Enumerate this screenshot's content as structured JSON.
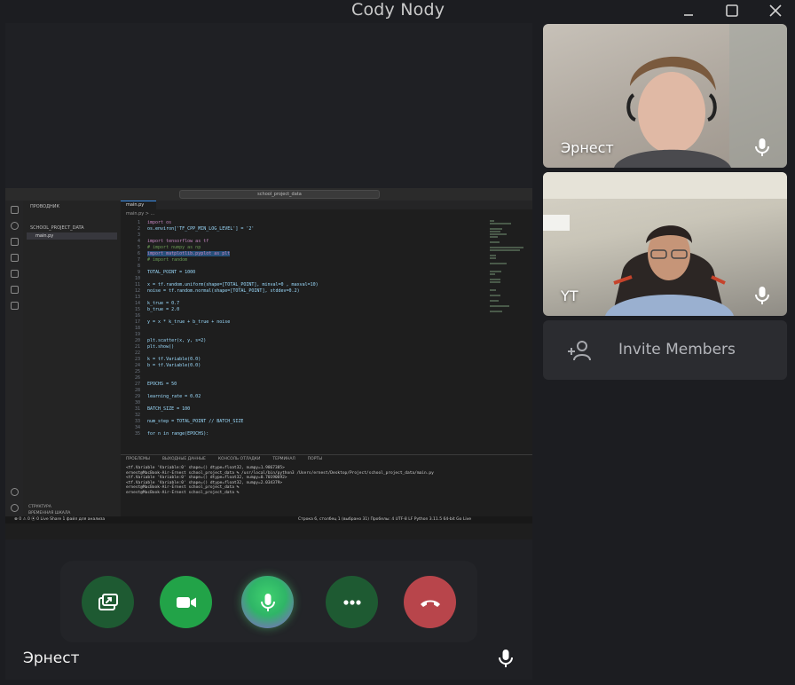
{
  "window": {
    "title": "Cody Nody"
  },
  "main_video": {
    "participant_name": "Эрнест"
  },
  "screen_share": {
    "search_text": "school_project_data",
    "explorer_title": "ПРОВОДНИК",
    "project_folder": "SCHOOL_PROJECT_DATA",
    "file": "main.py",
    "tab": "main.py",
    "breadcrumb": "main.py > ...",
    "outline_1": "СТРУКТУРА",
    "outline_2": "ВРЕМЕННАЯ ШКАЛА",
    "code_lines": [
      {
        "n": "1",
        "t": "import os"
      },
      {
        "n": "2",
        "t": "os.environ['TF_CPP_MIN_LOG_LEVEL'] = '2'"
      },
      {
        "n": "3",
        "t": ""
      },
      {
        "n": "4",
        "t": "import tensorflow as tf"
      },
      {
        "n": "5",
        "t": "# import numpy as np"
      },
      {
        "n": "6",
        "t": "import matplotlib.pyplot as plt"
      },
      {
        "n": "7",
        "t": "# import random"
      },
      {
        "n": "8",
        "t": ""
      },
      {
        "n": "9",
        "t": "TOTAL_POINT = 1000"
      },
      {
        "n": "10",
        "t": ""
      },
      {
        "n": "11",
        "t": "x = tf.random.uniform(shape=[TOTAL_POINT], minval=0 , maxval=10)"
      },
      {
        "n": "12",
        "t": "noise = tf.random.normal(shape=[TOTAL_POINT], stddev=0.2)"
      },
      {
        "n": "13",
        "t": ""
      },
      {
        "n": "14",
        "t": "k_true = 0.7"
      },
      {
        "n": "15",
        "t": "b_true = 2.0"
      },
      {
        "n": "16",
        "t": ""
      },
      {
        "n": "17",
        "t": "y = x * k_true + b_true + noise"
      },
      {
        "n": "18",
        "t": ""
      },
      {
        "n": "19",
        "t": ""
      },
      {
        "n": "20",
        "t": "plt.scatter(x, y, s=2)"
      },
      {
        "n": "21",
        "t": "plt.show()"
      },
      {
        "n": "22",
        "t": ""
      },
      {
        "n": "23",
        "t": "k = tf.Variable(0.0)"
      },
      {
        "n": "24",
        "t": "b = tf.Variable(0.0)"
      },
      {
        "n": "25",
        "t": ""
      },
      {
        "n": "26",
        "t": ""
      },
      {
        "n": "27",
        "t": "EPOCHS = 50"
      },
      {
        "n": "28",
        "t": ""
      },
      {
        "n": "29",
        "t": "learning_rate = 0.02"
      },
      {
        "n": "30",
        "t": ""
      },
      {
        "n": "31",
        "t": "BATCH_SIZE = 100"
      },
      {
        "n": "32",
        "t": ""
      },
      {
        "n": "33",
        "t": "num_step = TOTAL_POINT // BATCH_SIZE"
      },
      {
        "n": "34",
        "t": ""
      },
      {
        "n": "35",
        "t": "for n in range(EPOCHS):"
      }
    ],
    "panel_tabs": [
      "ПРОБЛЕМЫ",
      "ВЫХОДНЫЕ ДАННЫЕ",
      "КОНСОЛЬ ОТЛАДКИ",
      "ТЕРМИНАЛ",
      "ПОРТЫ"
    ],
    "terminal_lines": [
      "<tf.Variable 'Variable:0' shape=() dtype=float32, numpy=1.9867385>",
      "ernest@MacBook-Air-Ernest school_project_data % /usr/local/bin/python3 /Users/ernest/Desktop/Project/school_project_data/main.py",
      "<tf.Variable 'Variable:0' shape=() dtype=float32, numpy=0.70190692>",
      "<tf.Variable 'Variable:0' shape=() dtype=float32, numpy=2.034379>",
      "ernest@MacBook-Air-Ernest school_project_data %",
      "ernest@MacBook-Air-Ernest school_project_data %"
    ],
    "status_left": "⊗ 0 ⚠ 0   ⦿ 0   Live Share   1 файл для анализа",
    "status_right": "Строка 6, столбец 1 (выбрано 31)   Пробелы: 4   UTF-8   LF   Python   3.11.5 64-bit   Go Live"
  },
  "controls": {
    "share_icon": "screen-share-icon",
    "video_icon": "video-camera-icon",
    "mic_icon": "microphone-icon",
    "more_icon": "more-icon",
    "end_icon": "end-call-icon",
    "colors": {
      "share": "#1e5a32",
      "video": "#22a348",
      "more": "#1e5a32",
      "end": "#b8454b"
    }
  },
  "participants": [
    {
      "name": "Эрнест"
    },
    {
      "name": "YT"
    }
  ],
  "invite": {
    "label": "Invite Members",
    "icon": "add-person-icon"
  }
}
